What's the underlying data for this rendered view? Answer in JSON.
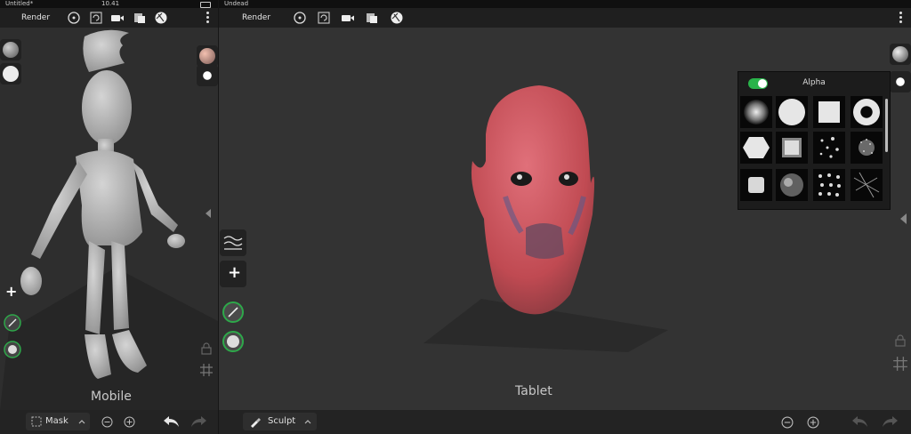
{
  "mobile": {
    "status": {
      "doc": "Untitled*",
      "time": "10.41"
    },
    "topbar": {
      "render_label": "Render"
    },
    "tool_label": "Mask",
    "caption": "Mobile"
  },
  "tablet": {
    "status": {
      "doc": "Undead"
    },
    "topbar": {
      "render_label": "Render"
    },
    "tool_label": "Sculpt",
    "caption": "Tablet",
    "alpha_panel": {
      "title": "Alpha",
      "enabled": true,
      "items": [
        "soft-blob",
        "circle",
        "square",
        "ring",
        "hexagon",
        "square-frame",
        "dots-sparse",
        "noise-fine",
        "noise-patch",
        "noise-cloud",
        "dots-grid",
        "noise-streak"
      ]
    }
  },
  "colors": {
    "accent_green": "#29b34a",
    "panel_bg": "#333333",
    "bar_bg": "#1f1f1f"
  }
}
